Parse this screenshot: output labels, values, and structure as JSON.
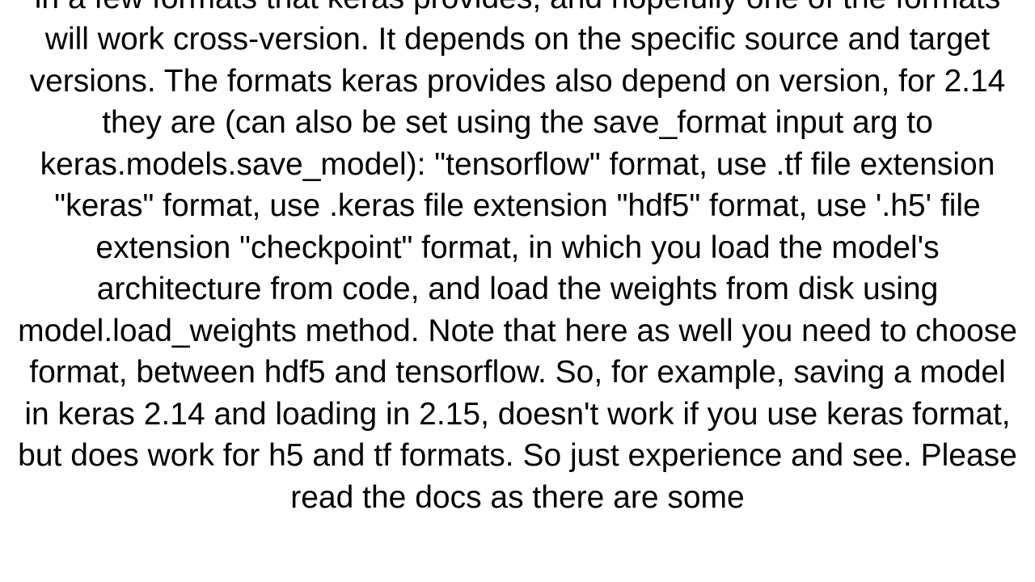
{
  "document": {
    "body_text": "in a few formats that keras provides, and hopefully one of the formats will work cross-version. It depends on the specific source and target versions. The formats keras provides also depend on version, for 2.14 they are (can also be set using the save_format input arg to keras.models.save_model):  \"tensorflow\" format, use .tf file extension \"keras\" format, use .keras file extension \"hdf5\" format, use '.h5' file extension \"checkpoint\" format, in which you load the model's architecture from code, and load the weights from disk using model.load_weights method. Note that here as well you need to choose format, between hdf5 and tensorflow.  So, for example, saving a model in keras 2.14 and loading in 2.15, doesn't work if you use keras format, but does work for h5 and tf formats. So just experience and see. Please read the docs as there are some"
  }
}
